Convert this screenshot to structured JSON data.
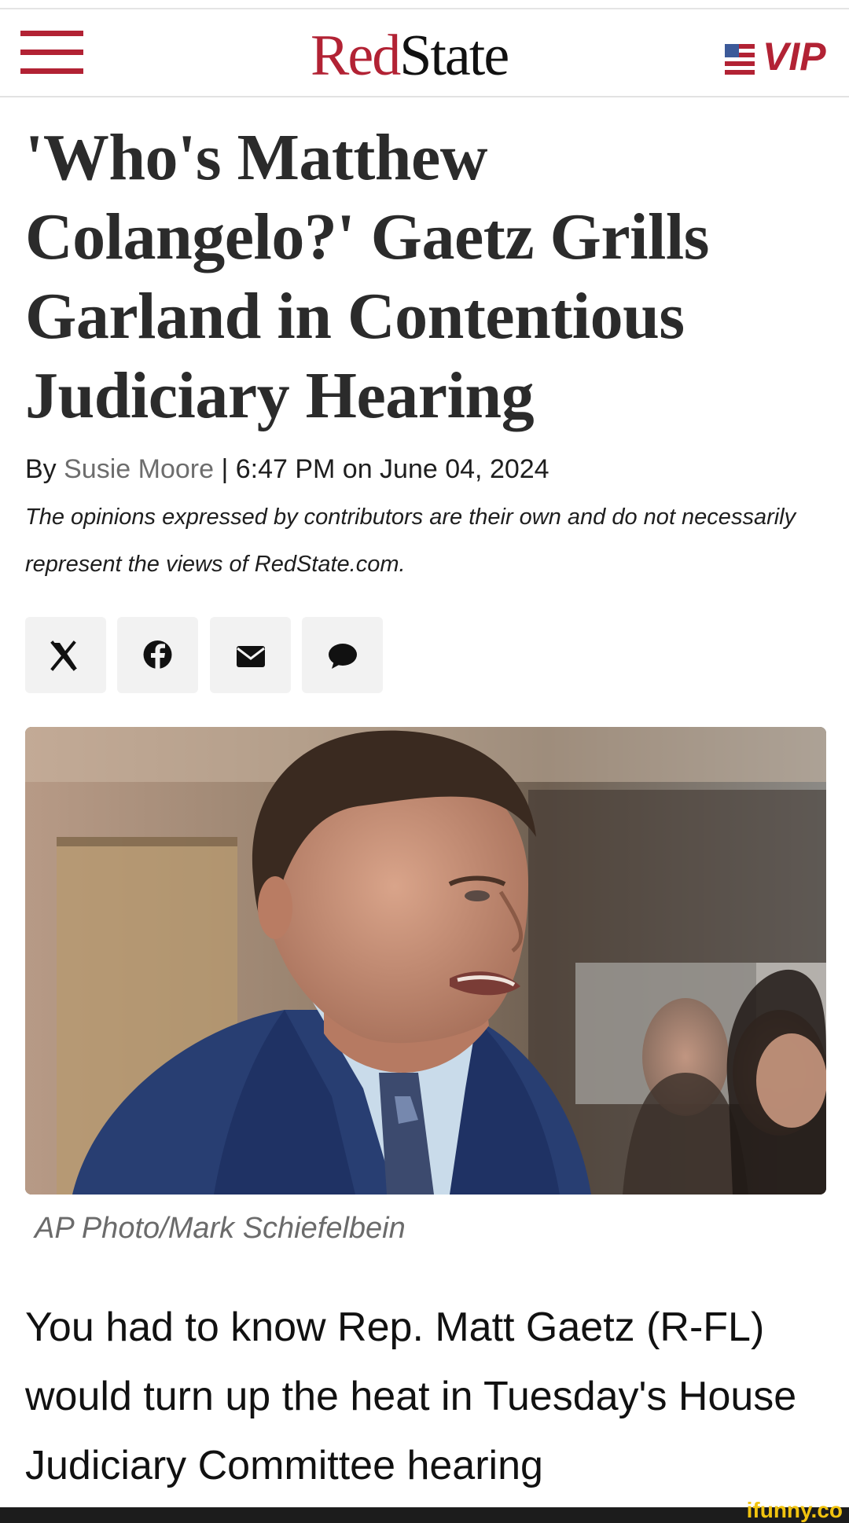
{
  "header": {
    "logo_red": "Red",
    "logo_dark": "State",
    "vip_label": "VIP",
    "menu_icon": "hamburger-menu-icon",
    "flag_icon": "us-flag-icon"
  },
  "article": {
    "headline": "'Who's Matthew Colangelo?' Gaetz Grills Garland in Contentious Judiciary Hearing",
    "byline_prefix": "By ",
    "author": "Susie Moore",
    "byline_suffix": " | 6:47 PM on June 04, 2024",
    "disclaimer": "The opinions expressed by contributors are their own and do not necessarily represent the views of RedState.com.",
    "share_buttons": [
      {
        "icon": "x-icon"
      },
      {
        "icon": "facebook-icon"
      },
      {
        "icon": "email-icon"
      },
      {
        "icon": "comment-icon"
      }
    ],
    "photo_caption": "AP Photo/Mark Schiefelbein",
    "body_text": "You had to know Rep. Matt Gaetz (R-FL) would turn up the heat in Tuesday's House Judiciary Committee hearing"
  },
  "watermark": "ifunny.co",
  "colors": {
    "brand_red": "#b22234",
    "flag_blue": "#3c5a99",
    "share_bg": "#f2f2f2",
    "author_gray": "#6d6d6d",
    "watermark_yellow": "#f2c40f"
  }
}
